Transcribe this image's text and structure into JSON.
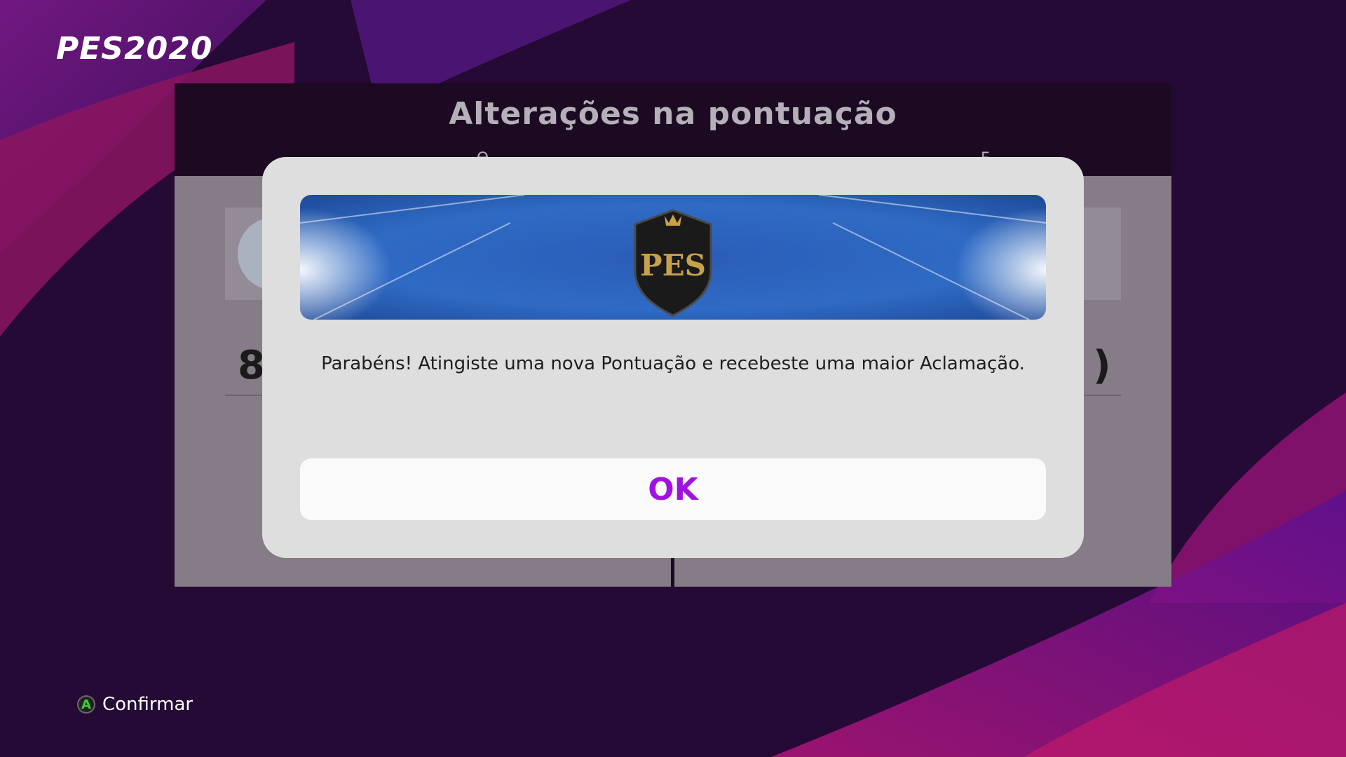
{
  "app": {
    "logo_text": "PES2020"
  },
  "panel": {
    "title": "Alterações na pontuação",
    "left_column_label": "Ө...",
    "right_column_label": "F...",
    "left_score_partial": "8",
    "right_score_partial": ")"
  },
  "dialog": {
    "banner_icon": "pes-crest-icon",
    "message": "Parabéns! Atingiste uma nova Pontuação e recebeste uma maior Aclamação.",
    "ok_label": "OK"
  },
  "footer": {
    "button_glyph": "A",
    "confirm_label": "Confirmar"
  },
  "colors": {
    "background": "#240a34",
    "accent_purple": "#a012e0",
    "dialog_bg": "#dedede",
    "banner_blue": "#2f6bc4",
    "a_button_green": "#38d430"
  }
}
